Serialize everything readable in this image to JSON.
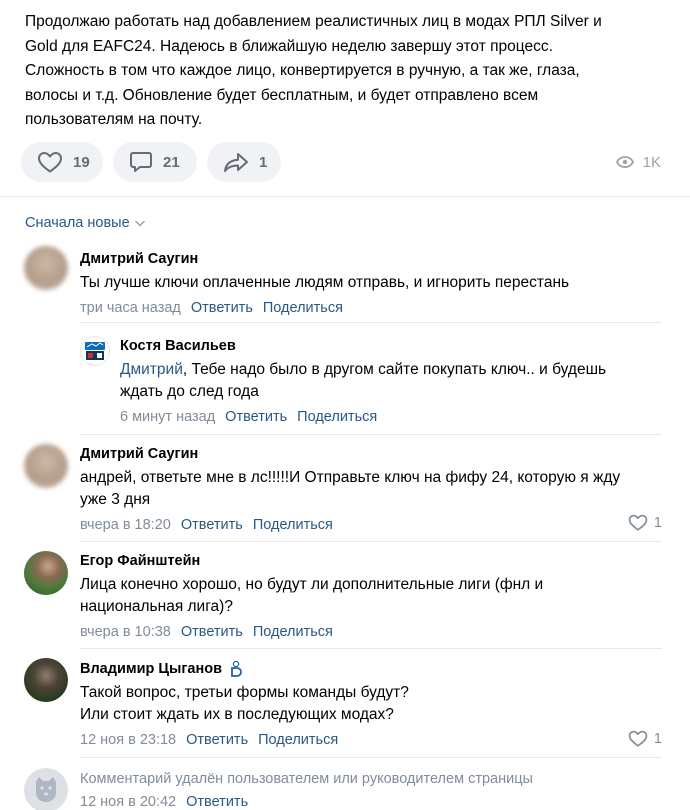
{
  "post": {
    "lines": [
      "Продолжаю работать над добавлением реалистичных лиц в модах РПЛ Silver и",
      "Gold для EAFC24. Надеюсь в ближайшую неделю завершу этот процесс.",
      "Сложность в том что каждое лицо, конвертируется в ручную, а так же, глаза,",
      "волосы и т.д. Обновление будет бесплатным, и будет отправлено всем",
      "пользователям на почту."
    ],
    "likes": "19",
    "comments": "21",
    "shares": "1",
    "views": "1K"
  },
  "sort_label": "Сначала новые",
  "colors": {
    "link": "#2a5885",
    "muted": "#818c99",
    "pill_bg": "#f0f2f5",
    "icon": "#626d7a"
  },
  "comments": [
    {
      "author": "Дмитрий Саугин",
      "lines": [
        "Ты лучше ключи оплаченные людям отправь, и игнорить перестань"
      ],
      "time": "три часа назад",
      "reply": "Ответить",
      "share": "Поделиться"
    },
    {
      "author": "Костя Васильев",
      "mention": "Дмитрий",
      "lines": [
        ", Тебе надо было в другом сайте покупать ключ.. и будешь",
        "ждать до след года"
      ],
      "time": "6 минут назад",
      "reply": "Ответить",
      "share": "Поделиться"
    },
    {
      "author": "Дмитрий Саугин",
      "lines": [
        "андрей, ответьте мне в лс!!!!!И Отправьте ключ на фифу 24, которую я жду",
        "уже 3 дня"
      ],
      "time": "вчера в 18:20",
      "reply": "Ответить",
      "share": "Поделиться",
      "likes": "1"
    },
    {
      "author": "Егор Файнштейн",
      "lines": [
        "Лица конечно хорошо, но будут ли дополнительные лиги (фнл и",
        "национальная лига)?"
      ],
      "time": "вчера в 10:38",
      "reply": "Ответить",
      "share": "Поделиться"
    },
    {
      "author": "Владимир Цыганов",
      "lines": [
        "Такой вопрос, третьи формы команды будут?",
        "Или стоит ждать их в последующих модах?"
      ],
      "time": "12 ноя в 23:18",
      "reply": "Ответить",
      "share": "Поделиться",
      "likes": "1"
    },
    {
      "text": "Комментарий удалён пользователем или руководителем страницы",
      "time": "12 ноя в 20:42",
      "reply": "Ответить"
    }
  ]
}
